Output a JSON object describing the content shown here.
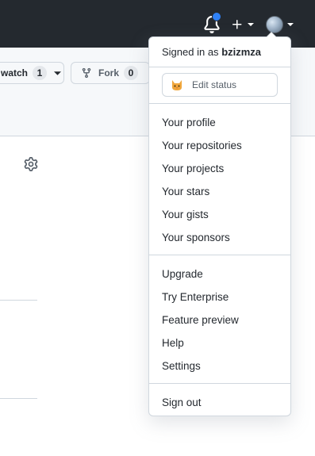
{
  "header": {
    "icons": [
      "bell-icon",
      "plus-icon",
      "caret-down-icon",
      "avatar"
    ],
    "notification_color": "#2f81f7"
  },
  "repo": {
    "watch_label": "watch",
    "watch_count": "1",
    "fork_label": "Fork",
    "fork_count": "0"
  },
  "dropdown": {
    "signed_in_prefix": "Signed in as",
    "username": "bzizmza",
    "edit_status": "Edit status",
    "profile_items": [
      "Your profile",
      "Your repositories",
      "Your projects",
      "Your stars",
      "Your gists",
      "Your sponsors"
    ],
    "other_items": [
      "Upgrade",
      "Try Enterprise",
      "Feature preview",
      "Help",
      "Settings"
    ],
    "sign_out": "Sign out"
  },
  "colors": {
    "header_bg": "#24292f",
    "border": "#d0d7de",
    "subheader_bg": "#f6f8fa"
  }
}
